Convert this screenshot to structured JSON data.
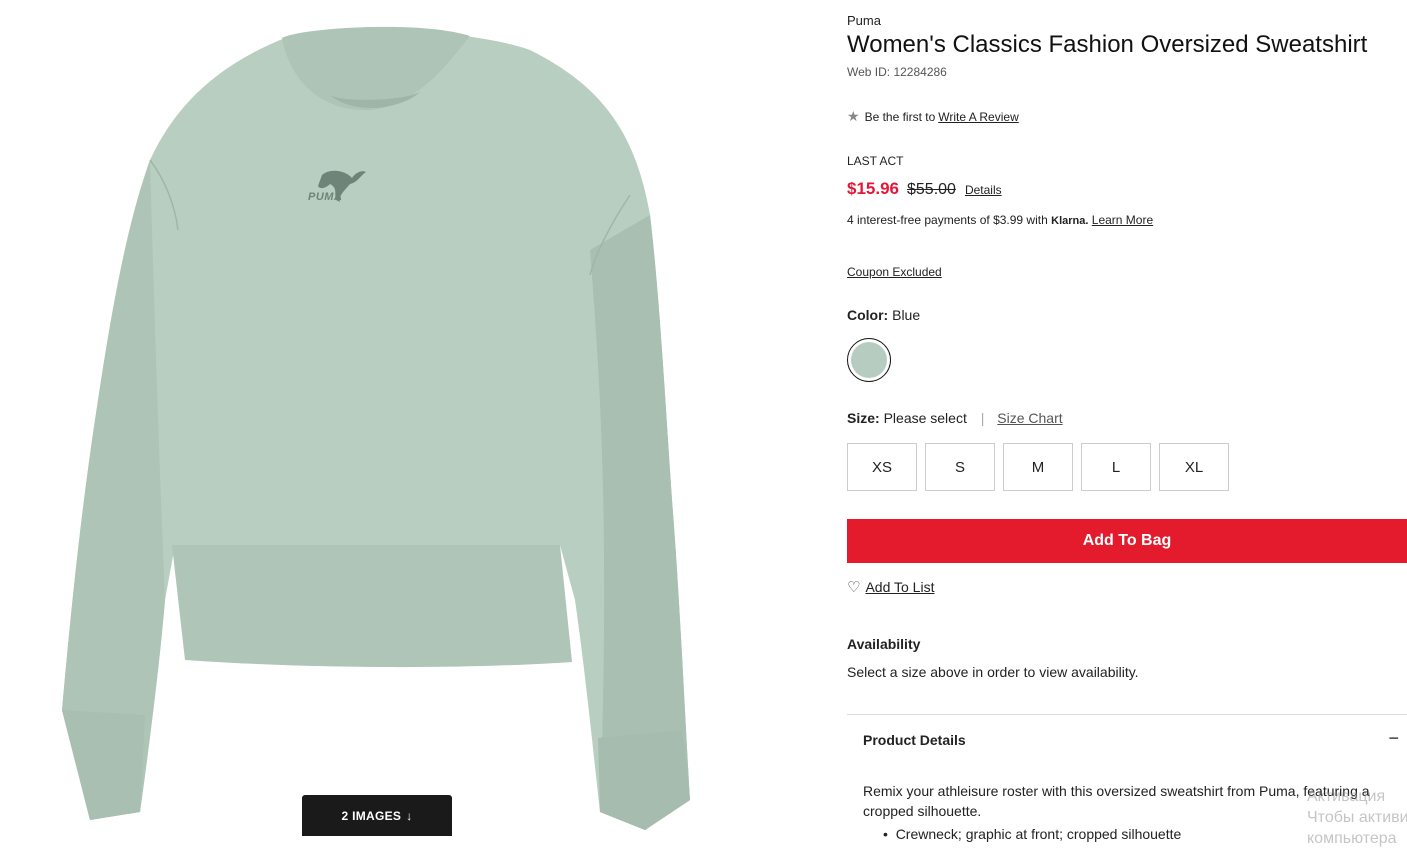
{
  "product": {
    "brand": "Puma",
    "title": "Women's Classics Fashion Oversized Sweatshirt",
    "web_id": "Web ID: 12284286"
  },
  "review": {
    "prefix": "Be the first to",
    "link": "Write A Review"
  },
  "price": {
    "label": "LAST ACT",
    "current": "$15.96",
    "original": "$55.00",
    "details_link": "Details"
  },
  "klarna": {
    "text": "4 interest-free payments of $3.99 with",
    "logo": "Klarna.",
    "link": "Learn More"
  },
  "coupon": "Coupon Excluded",
  "color": {
    "label": "Color:",
    "value": "Blue",
    "swatch_hex": "#b7ccc0"
  },
  "size": {
    "label": "Size:",
    "value": "Please select",
    "separator": "|",
    "chart_link": "Size Chart",
    "options": [
      "XS",
      "S",
      "M",
      "L",
      "XL"
    ]
  },
  "actions": {
    "add_to_bag": "Add To Bag",
    "add_to_list": "Add To List"
  },
  "availability": {
    "title": "Availability",
    "text": "Select a size above in order to view availability."
  },
  "product_details": {
    "title": "Product Details",
    "toggle": "−",
    "description": "Remix your athleisure roster with this oversized sweatshirt from Puma, featuring a cropped silhouette.",
    "bullet": "Crewneck; graphic at front; cropped silhouette"
  },
  "gallery": {
    "button_label": "2 IMAGES",
    "button_arrow": "↓",
    "logo_text": "PUMA"
  },
  "watermark": {
    "line1": "Активация",
    "line2": "Чтобы активи",
    "line3": "компьютера"
  },
  "colors": {
    "accent_red": "#e31b2d",
    "price_red": "#e31837",
    "garment": "#b7ccc0"
  }
}
